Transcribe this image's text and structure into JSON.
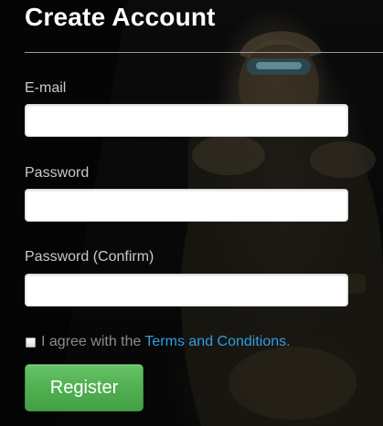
{
  "form": {
    "title": "Create Account",
    "email": {
      "label": "E-mail",
      "value": ""
    },
    "password": {
      "label": "Password",
      "value": ""
    },
    "password_confirm": {
      "label": "Password (Confirm)",
      "value": ""
    },
    "agree": {
      "text": "I agree with the",
      "link_text": "Terms and Conditions",
      "suffix": ".",
      "checked": false
    },
    "register_label": "Register"
  },
  "colors": {
    "link": "#2f9fe0",
    "button": "#52b052",
    "title": "#ffffff"
  }
}
